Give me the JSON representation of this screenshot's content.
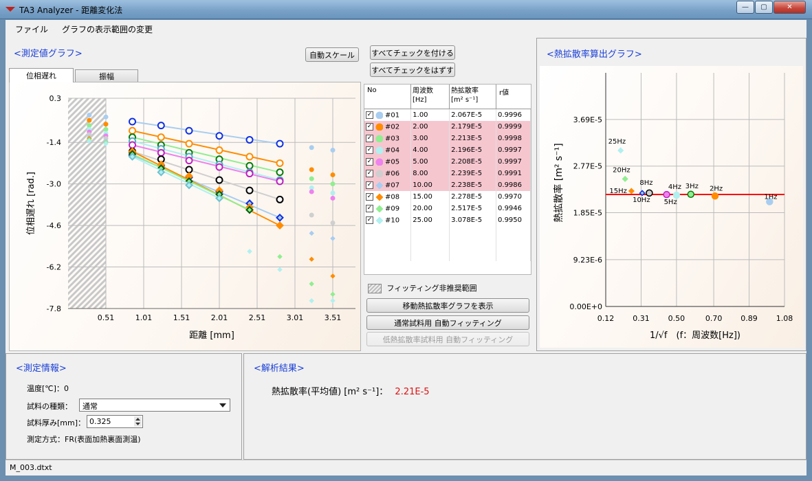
{
  "window": {
    "title": "TA3 Analyzer - 距離変化法",
    "minimize": "—",
    "maximize": "▢",
    "close": "✕"
  },
  "menu": [
    "ファイル",
    "グラフの表示範囲の変更"
  ],
  "measure_graph": {
    "title": "<測定値グラフ>",
    "auto_scale": "自動スケール",
    "tabs": [
      "位相遅れ",
      "振幅"
    ],
    "check_all": "すべてチェックを付ける",
    "uncheck_all": "すべてチェックをはずす"
  },
  "diffusivity_graph": {
    "title": "<熱拡散率算出グラフ>"
  },
  "table": {
    "headers": [
      {
        "l1": "No",
        "l2": ""
      },
      {
        "l1": "周波数",
        "l2": "[Hz]"
      },
      {
        "l1": "熱拡散率",
        "l2": "[m² s⁻¹]"
      },
      {
        "l1": "r値",
        "l2": ""
      }
    ],
    "rows": [
      {
        "no": "#01",
        "freq": "1.00",
        "diff": "2.067E-5",
        "r": "0.9996",
        "marker": "circle",
        "color": "#a8cdf0",
        "highlight": false
      },
      {
        "no": "#02",
        "freq": "2.00",
        "diff": "2.179E-5",
        "r": "0.9999",
        "marker": "circle",
        "color": "#ff8c00",
        "highlight": true
      },
      {
        "no": "#03",
        "freq": "3.00",
        "diff": "2.213E-5",
        "r": "0.9998",
        "marker": "circle",
        "color": "#90ee90",
        "highlight": true
      },
      {
        "no": "#04",
        "freq": "4.00",
        "diff": "2.196E-5",
        "r": "0.9997",
        "marker": "circle",
        "color": "#b0f0f0",
        "highlight": true
      },
      {
        "no": "#05",
        "freq": "5.00",
        "diff": "2.208E-5",
        "r": "0.9997",
        "marker": "circle",
        "color": "#ee82ee",
        "highlight": true
      },
      {
        "no": "#06",
        "freq": "8.00",
        "diff": "2.239E-5",
        "r": "0.9991",
        "marker": "circle",
        "color": "#cfcfcf",
        "highlight": true
      },
      {
        "no": "#07",
        "freq": "10.00",
        "diff": "2.238E-5",
        "r": "0.9986",
        "marker": "diamond",
        "color": "#a8cdf0",
        "highlight": true
      },
      {
        "no": "#08",
        "freq": "15.00",
        "diff": "2.278E-5",
        "r": "0.9970",
        "marker": "diamond",
        "color": "#ff8c00",
        "highlight": false
      },
      {
        "no": "#09",
        "freq": "20.00",
        "diff": "2.517E-5",
        "r": "0.9946",
        "marker": "diamond",
        "color": "#90ee90",
        "highlight": false
      },
      {
        "no": "#10",
        "freq": "25.00",
        "diff": "3.078E-5",
        "r": "0.9950",
        "marker": "diamond",
        "color": "#b0f0f0",
        "highlight": false
      }
    ]
  },
  "controls": {
    "legend_hatch": "フィッティング非推奨範囲",
    "show_moving": "移動熱拡散率グラフを表示",
    "auto_fit_normal": "通常試料用 自動フィッティング",
    "auto_fit_low": "低熱拡散率試料用 自動フィッティング"
  },
  "info": {
    "title": "<測定情報>",
    "temperature_label": "温度[℃]：",
    "temperature_value": "0",
    "sample_type_label": "試料の種類：",
    "sample_type_value": "通常",
    "thickness_label": "試料厚み[mm]：",
    "thickness_value": "0.325",
    "method_label": "測定方式：",
    "method_value": "FR(表面加熱裏面測温)"
  },
  "result": {
    "title": "<解析結果>",
    "label": "熱拡散率(平均値) [m² s⁻¹]：",
    "value": "2.21E-5",
    "value_color": "#e01010"
  },
  "status": {
    "file": "M_003.dtxt"
  },
  "chart_data": [
    {
      "type": "scatter",
      "title": "",
      "xlabel": "距離 [mm]",
      "ylabel": "位相遅れ [rad.]",
      "xlim": [
        0.01,
        3.81
      ],
      "ylim": [
        -7.8,
        0.3
      ],
      "x_ticks": [
        "0.51",
        "1.01",
        "1.51",
        "2.01",
        "2.51",
        "3.01",
        "3.51"
      ],
      "y_ticks": [
        "0.3",
        "-1.4",
        "-3.0",
        "-4.6",
        "-6.2",
        "-7.8"
      ],
      "hatch_range": [
        0.01,
        0.51
      ],
      "grid": true,
      "x": [
        0.29,
        0.51,
        0.86,
        1.24,
        1.61,
        2.01,
        2.41,
        2.81,
        3.23,
        3.51
      ],
      "series": [
        {
          "name": "#01",
          "color": "#a8cdf0",
          "marker": "circle",
          "edge": "#1030e0",
          "fit_range": [
            2,
            7
          ],
          "y": [
            -0.35,
            -0.42,
            -0.6,
            -0.75,
            -0.95,
            -1.15,
            -1.3,
            -1.45,
            -1.6,
            -1.7
          ]
        },
        {
          "name": "#02",
          "color": "#ff8c00",
          "marker": "circle",
          "edge": "#ff8c00",
          "fit_range": [
            2,
            7
          ],
          "y": [
            -0.55,
            -0.7,
            -0.95,
            -1.2,
            -1.45,
            -1.7,
            -1.95,
            -2.2,
            -2.45,
            -2.65
          ]
        },
        {
          "name": "#03",
          "color": "#90ee90",
          "marker": "circle",
          "edge": "#0a7a0a",
          "fit_range": [
            2,
            7
          ],
          "y": [
            -0.75,
            -0.9,
            -1.2,
            -1.5,
            -1.8,
            -2.05,
            -2.3,
            -2.55,
            -2.8,
            -3.0
          ]
        },
        {
          "name": "#04",
          "color": "#b0f0f0",
          "marker": "circle",
          "edge": "#50b0c0",
          "fit_range": [
            2,
            7
          ],
          "y": [
            -0.9,
            -1.05,
            -1.35,
            -1.65,
            -1.95,
            -2.25,
            -2.55,
            -2.85,
            -3.15,
            -3.35
          ]
        },
        {
          "name": "#05",
          "color": "#ee82ee",
          "marker": "circle",
          "edge": "#c020c0",
          "fit_range": [
            2,
            7
          ],
          "y": [
            -1.0,
            -1.15,
            -1.5,
            -1.8,
            -2.1,
            -2.35,
            -2.6,
            -2.9,
            -3.3,
            -3.55
          ]
        },
        {
          "name": "#06",
          "color": "#cfcfcf",
          "marker": "circle",
          "edge": "#000000",
          "fit_range": [
            2,
            7
          ],
          "y": [
            -1.1,
            -1.25,
            -1.75,
            -2.05,
            -2.45,
            -2.85,
            -3.25,
            -3.6,
            -4.2,
            -4.5
          ]
        },
        {
          "name": "#07",
          "color": "#a8cdf0",
          "marker": "diamond",
          "edge": "#1030e0",
          "fit_range": [
            2,
            7
          ],
          "y": [
            -1.2,
            -1.35,
            -1.9,
            -2.3,
            -2.75,
            -3.3,
            -3.75,
            -4.3,
            -4.9,
            -5.1
          ]
        },
        {
          "name": "#08",
          "color": "#ff8c00",
          "marker": "diamond",
          "edge": "#ff8c00",
          "fit_range": [
            2,
            7
          ],
          "y": [
            -1.25,
            -1.4,
            -1.75,
            -2.25,
            -2.7,
            -3.25,
            -3.9,
            -4.6,
            -5.9,
            -6.55
          ]
        },
        {
          "name": "#09",
          "color": "#90ee90",
          "marker": "diamond",
          "edge": "#0a5a0a",
          "fit_range": [
            2,
            6
          ],
          "y": [
            -1.3,
            -1.4,
            -1.85,
            -2.4,
            -2.9,
            -3.4,
            -4.0,
            -5.8,
            -6.85,
            -7.25
          ]
        },
        {
          "name": "#10",
          "color": "#b0f0f0",
          "marker": "diamond",
          "edge": "#70c0d0",
          "fit_range": [
            2,
            5
          ],
          "y": [
            -1.35,
            -1.45,
            -1.95,
            -2.55,
            -3.05,
            -3.55,
            -5.6,
            -6.3,
            -7.5,
            -7.5
          ]
        }
      ]
    },
    {
      "type": "scatter",
      "title": "",
      "xlabel": "1/√f　(f：周波数[Hz])",
      "ylabel": "熱拡散率 [m² s⁻¹]",
      "xlim": [
        0.12,
        1.08
      ],
      "ylim": [
        0.0,
        4.61e-05
      ],
      "x_ticks": [
        "0.12",
        "0.31",
        "0.50",
        "0.70",
        "0.89",
        "1.08"
      ],
      "y_ticks": [
        "0.00E+0",
        "9.23E-6",
        "1.85E-5",
        "2.77E-5",
        "3.69E-5"
      ],
      "reference_line": {
        "value": 2.21e-05,
        "color": "#ff0000"
      },
      "grid": true,
      "points": [
        {
          "label": "1Hz",
          "x": 1.0,
          "y": 2.067e-05,
          "color": "#a8cdf0",
          "marker": "circle",
          "edge": "#a8cdf0"
        },
        {
          "label": "2Hz",
          "x": 0.707,
          "y": 2.179e-05,
          "color": "#ff8c00",
          "marker": "circle",
          "edge": "#ff8c00"
        },
        {
          "label": "3Hz",
          "x": 0.577,
          "y": 2.213e-05,
          "color": "#90ee90",
          "marker": "circle",
          "edge": "#0a7a0a"
        },
        {
          "label": "4Hz",
          "x": 0.5,
          "y": 2.196e-05,
          "color": "#b0f0f0",
          "marker": "circle",
          "edge": "#b0f0f0"
        },
        {
          "label": "5Hz",
          "x": 0.447,
          "y": 2.208e-05,
          "color": "#ee82ee",
          "marker": "circle",
          "edge": "#c020c0"
        },
        {
          "label": "8Hz",
          "x": 0.354,
          "y": 2.239e-05,
          "color": "#cfcfcf",
          "marker": "circle",
          "edge": "#000000"
        },
        {
          "label": "10Hz",
          "x": 0.316,
          "y": 2.238e-05,
          "color": "#a8cdf0",
          "marker": "diamond",
          "edge": "#1030e0"
        },
        {
          "label": "15Hz",
          "x": 0.258,
          "y": 2.278e-05,
          "color": "#ff8c00",
          "marker": "diamond",
          "edge": "#ff8c00"
        },
        {
          "label": "20Hz",
          "x": 0.224,
          "y": 2.517e-05,
          "color": "#90ee90",
          "marker": "diamond",
          "edge": "#90ee90"
        },
        {
          "label": "25Hz",
          "x": 0.2,
          "y": 3.078e-05,
          "color": "#b0f0f0",
          "marker": "diamond",
          "edge": "#b0f0f0"
        }
      ]
    }
  ]
}
